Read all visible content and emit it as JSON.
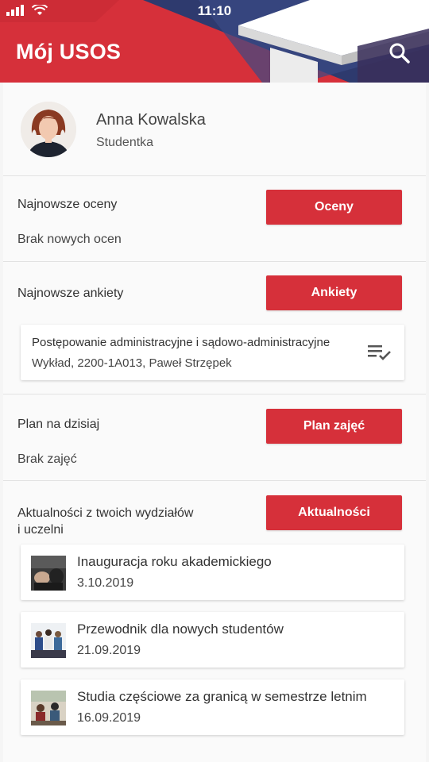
{
  "status_bar": {
    "time": "11:10"
  },
  "header": {
    "title": "Mój USOS"
  },
  "profile": {
    "name": "Anna Kowalska",
    "role": "Studentka"
  },
  "grades": {
    "title": "Najnowsze oceny",
    "button": "Oceny",
    "empty_text": "Brak nowych ocen"
  },
  "surveys": {
    "title": "Najnowsze ankiety",
    "button": "Ankiety",
    "item": {
      "title": "Postępowanie administracyjne i sądowo-administracyjne",
      "subtitle": "Wykład, 2200-1A013, Paweł Strzępek"
    }
  },
  "plan": {
    "title": "Plan na dzisiaj",
    "button": "Plan zajęć",
    "empty_text": "Brak zajęć"
  },
  "news": {
    "title_line1": "Aktualności z twoich wydziałów",
    "title_line2": "i uczelni",
    "button": "Aktualności",
    "items": [
      {
        "title": "Inauguracja roku akademickiego",
        "date": "3.10.2019"
      },
      {
        "title": "Przewodnik dla nowych studentów",
        "date": "21.09.2019"
      },
      {
        "title": "Studia częściowe za granicą w semestrze letnim",
        "date": "16.09.2019"
      }
    ]
  },
  "colors": {
    "brand_red": "#d6303a",
    "header_navy": "#2e3a6e"
  },
  "icons": {
    "search": "search-icon",
    "survey": "checklist-icon",
    "wifi": "wifi-icon",
    "signal": "signal-icon",
    "battery": "battery-icon"
  }
}
